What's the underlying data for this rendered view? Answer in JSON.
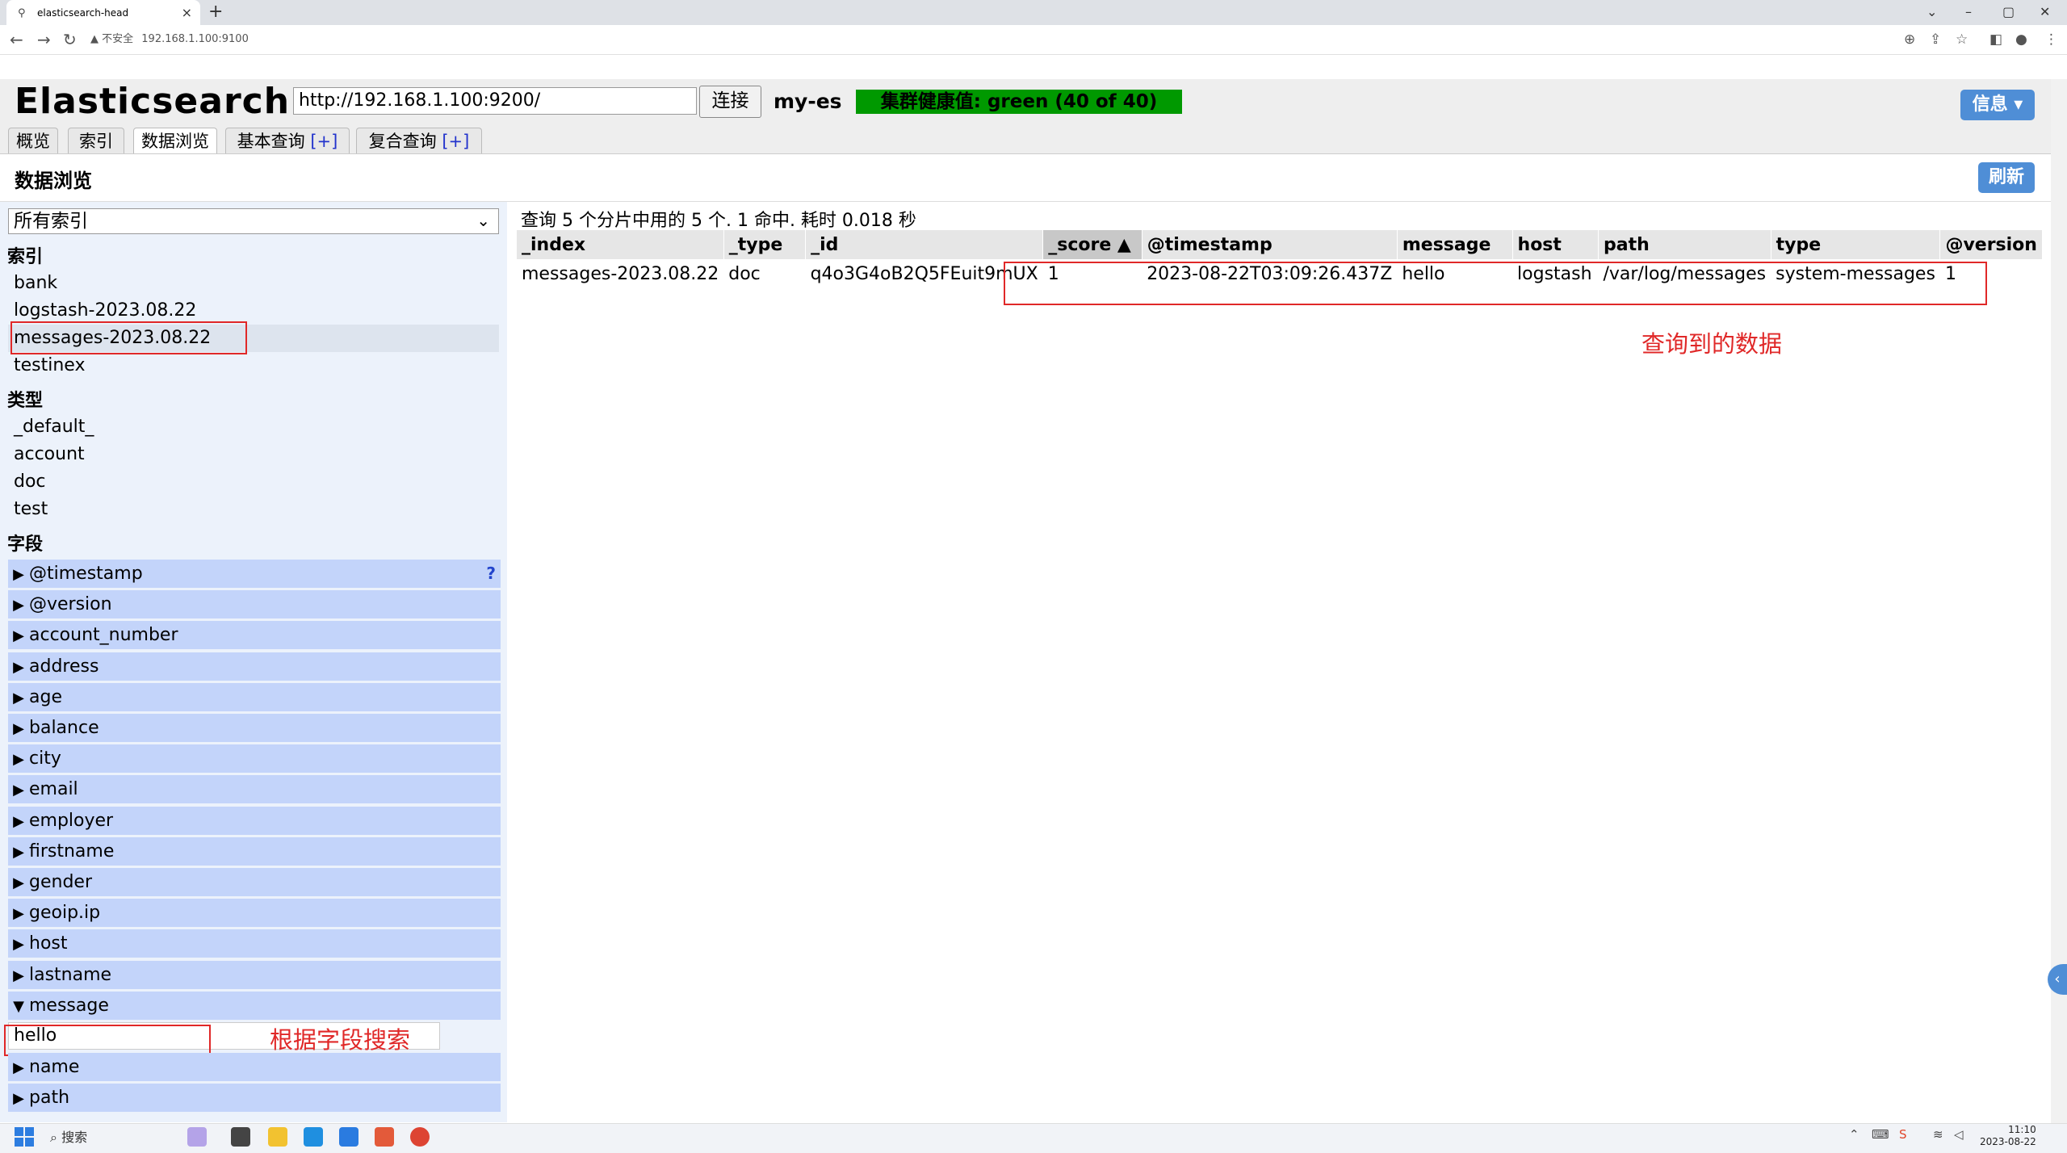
{
  "browser": {
    "tab_title": "elasticsearch-head",
    "address_warning": "▲ 不安全",
    "address_url": "192.168.1.100:9100"
  },
  "app": {
    "logo": "Elasticsearch",
    "url_input_value": "http://192.168.1.100:9200/",
    "connect_label": "连接",
    "cluster_name": "my-es",
    "health_text": "集群健康值: green (40 of 40)",
    "info_label": "信息 ▾",
    "tabs": [
      {
        "label": "概览"
      },
      {
        "label": "索引"
      },
      {
        "label": "数据浏览"
      },
      {
        "label": "基本查询",
        "plus": "[+]"
      },
      {
        "label": "复合查询",
        "plus": "[+]"
      }
    ],
    "page_title": "数据浏览",
    "refresh_label": "刷新"
  },
  "sidebar": {
    "index_select": "所有索引",
    "index_heading": "索引",
    "indices": [
      "bank",
      "logstash-2023.08.22",
      "messages-2023.08.22",
      "testinex"
    ],
    "type_heading": "类型",
    "types": [
      "_default_",
      "account",
      "doc",
      "test"
    ],
    "field_heading": "字段",
    "fields": [
      "@timestamp",
      "@version",
      "account_number",
      "address",
      "age",
      "balance",
      "city",
      "email",
      "employer",
      "firstname",
      "gender",
      "geoip.ip",
      "host",
      "lastname",
      "message"
    ],
    "fields_after": [
      "name",
      "path"
    ],
    "help_mark": "?",
    "message_filter_value": "hello"
  },
  "annotations": {
    "field_search": "根据字段搜索",
    "query_data": "查询到的数据"
  },
  "results": {
    "summary": "查询 5 个分片中用的 5 个. 1 命中. 耗时 0.018 秒",
    "columns": [
      "_index",
      "_type",
      "_id",
      "_score ▲",
      "@timestamp",
      "message",
      "host",
      "path",
      "type",
      "@version"
    ],
    "rows": [
      [
        "messages-2023.08.22",
        "doc",
        "q4o3G4oB2Q5FEuit9mUX",
        "1",
        "2023-08-22T03:09:26.437Z",
        "hello",
        "logstash",
        "/var/log/messages",
        "system-messages",
        "1"
      ]
    ]
  },
  "taskbar": {
    "search_label": "搜索",
    "time": "11:10",
    "date": "2023-08-22"
  }
}
